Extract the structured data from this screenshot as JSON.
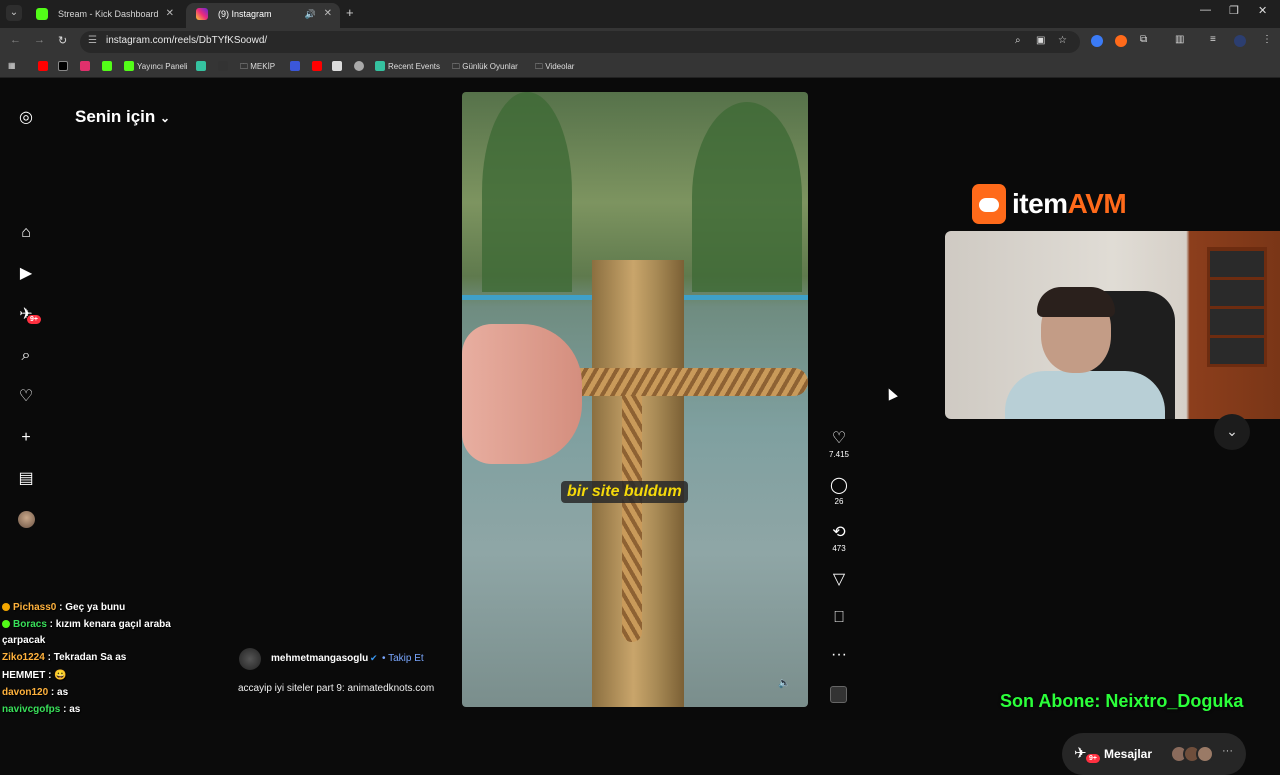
{
  "browser": {
    "tabs": [
      {
        "title": "Stream - Kick Dashboard"
      },
      {
        "title": "(9) Instagram"
      }
    ],
    "url": "instagram.com/reels/DbTYfKSoowd/",
    "bookmarks": [
      "Yayıncı Paneli",
      "MEKİP",
      "Recent Events",
      "Günlük Oyunlar",
      "Videolar"
    ]
  },
  "instagram": {
    "feed_title": "Senin için",
    "nav_badge": "9+",
    "reel": {
      "caption_overlay": "bir site buldum",
      "likes": "7.415",
      "comments": "26",
      "reposts": "473",
      "author": "mehmetmangasoglu",
      "follow_label": "• Takip Et",
      "description": "accayip iyi siteler part 9: animatedknots.com"
    },
    "messages": {
      "label": "Mesajlar",
      "badge": "9+"
    }
  },
  "stream_overlay": {
    "sponsor_prefix": "item",
    "sponsor_suffix": "AVM",
    "subscriber_banner": "Son Abone: Neixtro_Doguka",
    "chat": [
      {
        "user": "Pichass0",
        "message": " : Geç ya bunu"
      },
      {
        "user": "Boracs",
        "message": " : kızım kenara gaçıl araba"
      },
      {
        "user": "",
        "message": "çarpacak"
      },
      {
        "user": "Ziko1224",
        "message": " : Tekradan Sa as"
      },
      {
        "user": "HEMMET",
        "message": " : 😀"
      },
      {
        "user": "davon120",
        "message": " : as"
      },
      {
        "user": "navivcgofps",
        "message": " : as"
      }
    ]
  }
}
